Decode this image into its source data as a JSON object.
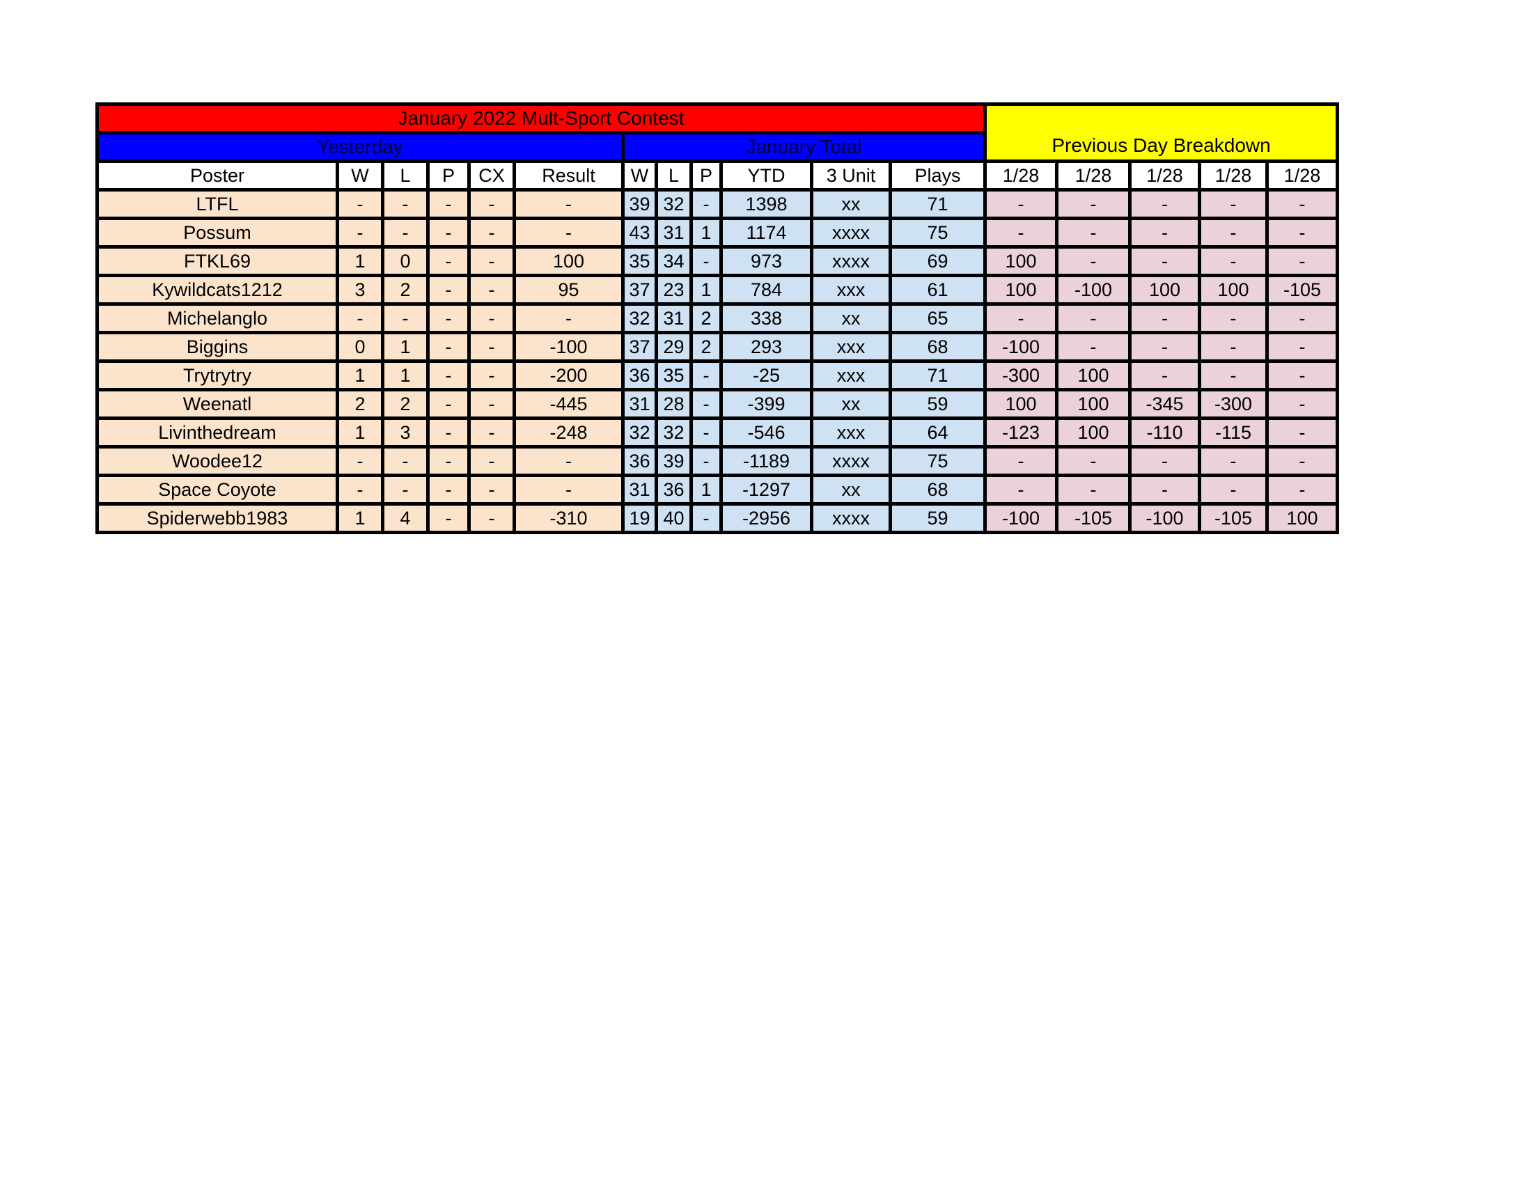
{
  "title": "January 2022 Mult-Sport Contest",
  "groups": {
    "yesterday": "Yesterday",
    "january_total": "January Total",
    "previous_day": "Previous Day Breakdown"
  },
  "colors": {
    "title_bg": "#ff0000",
    "group_bg": "#0000ff",
    "previous_day_bg": "#ffff00",
    "yesterday_cells": "#fce4cc",
    "january_cells": "#cfe2f3",
    "breakdown_cells": "#ead1dc"
  },
  "columns": {
    "poster": "Poster",
    "yesterday": [
      "W",
      "L",
      "P",
      "CX",
      "Result"
    ],
    "january": [
      "W",
      "L",
      "P",
      "YTD",
      "3 Unit",
      "Plays"
    ],
    "breakdown": [
      "1/28",
      "1/28",
      "1/28",
      "1/28",
      "1/28"
    ]
  },
  "rows": [
    {
      "poster": "LTFL",
      "yesterday": [
        "-",
        "-",
        "-",
        "-",
        "-"
      ],
      "january": [
        "39",
        "32",
        "-",
        "1398",
        "xx",
        "71"
      ],
      "breakdown": [
        "-",
        "-",
        "-",
        "-",
        "-"
      ]
    },
    {
      "poster": "Possum",
      "yesterday": [
        "-",
        "-",
        "-",
        "-",
        "-"
      ],
      "january": [
        "43",
        "31",
        "1",
        "1174",
        "xxxx",
        "75"
      ],
      "breakdown": [
        "-",
        "-",
        "-",
        "-",
        "-"
      ]
    },
    {
      "poster": "FTKL69",
      "yesterday": [
        "1",
        "0",
        "-",
        "-",
        "100"
      ],
      "january": [
        "35",
        "34",
        "-",
        "973",
        "xxxx",
        "69"
      ],
      "breakdown": [
        "100",
        "-",
        "-",
        "-",
        "-"
      ]
    },
    {
      "poster": "Kywildcats1212",
      "yesterday": [
        "3",
        "2",
        "-",
        "-",
        "95"
      ],
      "january": [
        "37",
        "23",
        "1",
        "784",
        "xxx",
        "61"
      ],
      "breakdown": [
        "100",
        "-100",
        "100",
        "100",
        "-105"
      ]
    },
    {
      "poster": "Michelanglo",
      "yesterday": [
        "-",
        "-",
        "-",
        "-",
        "-"
      ],
      "january": [
        "32",
        "31",
        "2",
        "338",
        "xx",
        "65"
      ],
      "breakdown": [
        "-",
        "-",
        "-",
        "-",
        "-"
      ]
    },
    {
      "poster": "Biggins",
      "yesterday": [
        "0",
        "1",
        "-",
        "-",
        "-100"
      ],
      "january": [
        "37",
        "29",
        "2",
        "293",
        "xxx",
        "68"
      ],
      "breakdown": [
        "-100",
        "-",
        "-",
        "-",
        "-"
      ]
    },
    {
      "poster": "Trytrytry",
      "yesterday": [
        "1",
        "1",
        "-",
        "-",
        "-200"
      ],
      "january": [
        "36",
        "35",
        "-",
        "-25",
        "xxx",
        "71"
      ],
      "breakdown": [
        "-300",
        "100",
        "-",
        "-",
        "-"
      ]
    },
    {
      "poster": "Weenatl",
      "yesterday": [
        "2",
        "2",
        "-",
        "-",
        "-445"
      ],
      "january": [
        "31",
        "28",
        "-",
        "-399",
        "xx",
        "59"
      ],
      "breakdown": [
        "100",
        "100",
        "-345",
        "-300",
        "-"
      ]
    },
    {
      "poster": "Livinthedream",
      "yesterday": [
        "1",
        "3",
        "-",
        "-",
        "-248"
      ],
      "january": [
        "32",
        "32",
        "-",
        "-546",
        "xxx",
        "64"
      ],
      "breakdown": [
        "-123",
        "100",
        "-110",
        "-115",
        "-"
      ]
    },
    {
      "poster": "Woodee12",
      "yesterday": [
        "-",
        "-",
        "-",
        "-",
        "-"
      ],
      "january": [
        "36",
        "39",
        "-",
        "-1189",
        "xxxx",
        "75"
      ],
      "breakdown": [
        "-",
        "-",
        "-",
        "-",
        "-"
      ]
    },
    {
      "poster": "Space Coyote",
      "yesterday": [
        "-",
        "-",
        "-",
        "-",
        "-"
      ],
      "january": [
        "31",
        "36",
        "1",
        "-1297",
        "xx",
        "68"
      ],
      "breakdown": [
        "-",
        "-",
        "-",
        "-",
        "-"
      ]
    },
    {
      "poster": "Spiderwebb1983",
      "yesterday": [
        "1",
        "4",
        "-",
        "-",
        "-310"
      ],
      "january": [
        "19",
        "40",
        "-",
        "-2956",
        "xxxx",
        "59"
      ],
      "breakdown": [
        "-100",
        "-105",
        "-100",
        "-105",
        "100"
      ]
    }
  ]
}
